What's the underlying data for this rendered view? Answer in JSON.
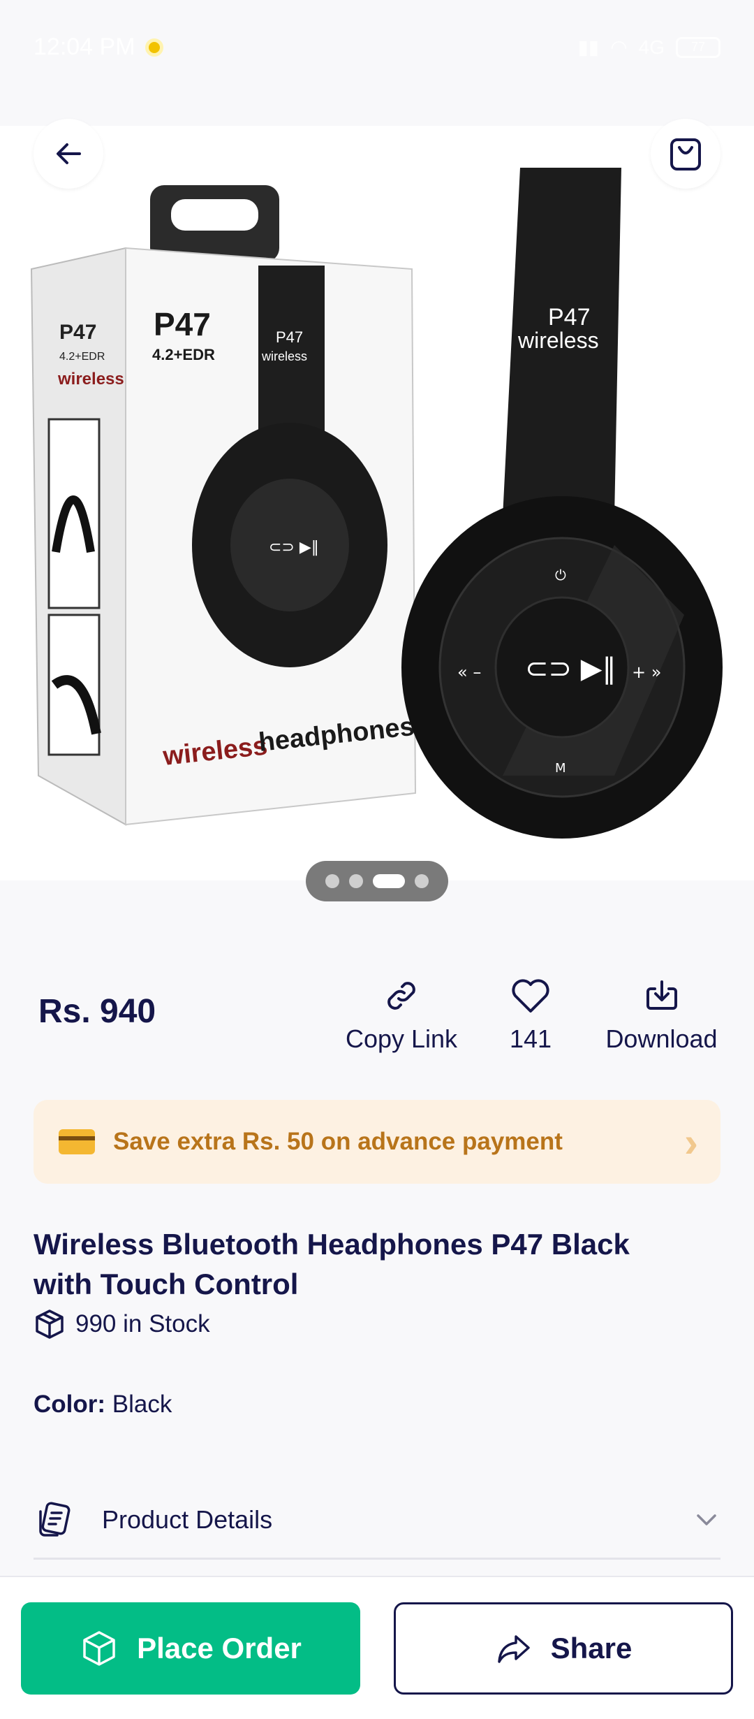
{
  "status_bar": {
    "time": "12:04 PM",
    "network": "4G",
    "battery": "77"
  },
  "product": {
    "price": "Rs. 940",
    "title": "Wireless Bluetooth Headphones P47 Black with Touch Control",
    "stock": "990 in Stock",
    "color_label": "Color:",
    "color_value": "Black"
  },
  "image_text": {
    "box_model": "P47",
    "box_spec": "4.2+EDR",
    "box_side": "wireless",
    "box_caption_red": "wireless",
    "box_caption_black": "headphones",
    "headband_model": "P47",
    "headband_word": "wireless",
    "carousel_count": 4,
    "carousel_active": 3
  },
  "actions": {
    "copy_link": "Copy Link",
    "likes": "141",
    "download": "Download"
  },
  "promo": {
    "text": "Save extra Rs. 50 on advance payment"
  },
  "details": {
    "label": "Product Details"
  },
  "buttons": {
    "place_order": "Place Order",
    "share": "Share"
  },
  "colors": {
    "accent_green": "#03bd86",
    "navy": "#15164a",
    "promo_bg": "#fdf1e2",
    "promo_text": "#b8741a"
  }
}
